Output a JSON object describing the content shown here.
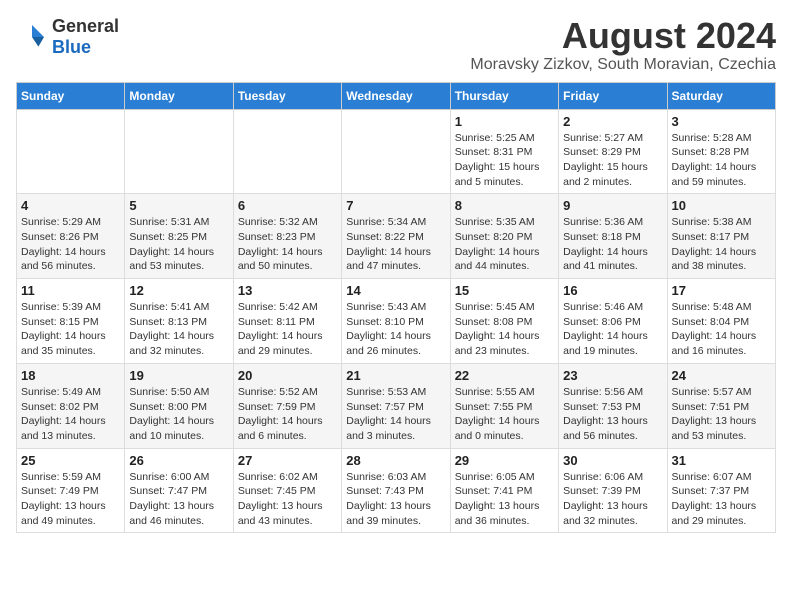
{
  "header": {
    "logo_general": "General",
    "logo_blue": "Blue",
    "title": "August 2024",
    "subtitle": "Moravsky Zizkov, South Moravian, Czechia"
  },
  "calendar": {
    "days_of_week": [
      "Sunday",
      "Monday",
      "Tuesday",
      "Wednesday",
      "Thursday",
      "Friday",
      "Saturday"
    ],
    "weeks": [
      {
        "cells": [
          {
            "day": "",
            "info": ""
          },
          {
            "day": "",
            "info": ""
          },
          {
            "day": "",
            "info": ""
          },
          {
            "day": "",
            "info": ""
          },
          {
            "day": "1",
            "info": "Sunrise: 5:25 AM\nSunset: 8:31 PM\nDaylight: 15 hours\nand 5 minutes."
          },
          {
            "day": "2",
            "info": "Sunrise: 5:27 AM\nSunset: 8:29 PM\nDaylight: 15 hours\nand 2 minutes."
          },
          {
            "day": "3",
            "info": "Sunrise: 5:28 AM\nSunset: 8:28 PM\nDaylight: 14 hours\nand 59 minutes."
          }
        ]
      },
      {
        "cells": [
          {
            "day": "4",
            "info": "Sunrise: 5:29 AM\nSunset: 8:26 PM\nDaylight: 14 hours\nand 56 minutes."
          },
          {
            "day": "5",
            "info": "Sunrise: 5:31 AM\nSunset: 8:25 PM\nDaylight: 14 hours\nand 53 minutes."
          },
          {
            "day": "6",
            "info": "Sunrise: 5:32 AM\nSunset: 8:23 PM\nDaylight: 14 hours\nand 50 minutes."
          },
          {
            "day": "7",
            "info": "Sunrise: 5:34 AM\nSunset: 8:22 PM\nDaylight: 14 hours\nand 47 minutes."
          },
          {
            "day": "8",
            "info": "Sunrise: 5:35 AM\nSunset: 8:20 PM\nDaylight: 14 hours\nand 44 minutes."
          },
          {
            "day": "9",
            "info": "Sunrise: 5:36 AM\nSunset: 8:18 PM\nDaylight: 14 hours\nand 41 minutes."
          },
          {
            "day": "10",
            "info": "Sunrise: 5:38 AM\nSunset: 8:17 PM\nDaylight: 14 hours\nand 38 minutes."
          }
        ]
      },
      {
        "cells": [
          {
            "day": "11",
            "info": "Sunrise: 5:39 AM\nSunset: 8:15 PM\nDaylight: 14 hours\nand 35 minutes."
          },
          {
            "day": "12",
            "info": "Sunrise: 5:41 AM\nSunset: 8:13 PM\nDaylight: 14 hours\nand 32 minutes."
          },
          {
            "day": "13",
            "info": "Sunrise: 5:42 AM\nSunset: 8:11 PM\nDaylight: 14 hours\nand 29 minutes."
          },
          {
            "day": "14",
            "info": "Sunrise: 5:43 AM\nSunset: 8:10 PM\nDaylight: 14 hours\nand 26 minutes."
          },
          {
            "day": "15",
            "info": "Sunrise: 5:45 AM\nSunset: 8:08 PM\nDaylight: 14 hours\nand 23 minutes."
          },
          {
            "day": "16",
            "info": "Sunrise: 5:46 AM\nSunset: 8:06 PM\nDaylight: 14 hours\nand 19 minutes."
          },
          {
            "day": "17",
            "info": "Sunrise: 5:48 AM\nSunset: 8:04 PM\nDaylight: 14 hours\nand 16 minutes."
          }
        ]
      },
      {
        "cells": [
          {
            "day": "18",
            "info": "Sunrise: 5:49 AM\nSunset: 8:02 PM\nDaylight: 14 hours\nand 13 minutes."
          },
          {
            "day": "19",
            "info": "Sunrise: 5:50 AM\nSunset: 8:00 PM\nDaylight: 14 hours\nand 10 minutes."
          },
          {
            "day": "20",
            "info": "Sunrise: 5:52 AM\nSunset: 7:59 PM\nDaylight: 14 hours\nand 6 minutes."
          },
          {
            "day": "21",
            "info": "Sunrise: 5:53 AM\nSunset: 7:57 PM\nDaylight: 14 hours\nand 3 minutes."
          },
          {
            "day": "22",
            "info": "Sunrise: 5:55 AM\nSunset: 7:55 PM\nDaylight: 14 hours\nand 0 minutes."
          },
          {
            "day": "23",
            "info": "Sunrise: 5:56 AM\nSunset: 7:53 PM\nDaylight: 13 hours\nand 56 minutes."
          },
          {
            "day": "24",
            "info": "Sunrise: 5:57 AM\nSunset: 7:51 PM\nDaylight: 13 hours\nand 53 minutes."
          }
        ]
      },
      {
        "cells": [
          {
            "day": "25",
            "info": "Sunrise: 5:59 AM\nSunset: 7:49 PM\nDaylight: 13 hours\nand 49 minutes."
          },
          {
            "day": "26",
            "info": "Sunrise: 6:00 AM\nSunset: 7:47 PM\nDaylight: 13 hours\nand 46 minutes."
          },
          {
            "day": "27",
            "info": "Sunrise: 6:02 AM\nSunset: 7:45 PM\nDaylight: 13 hours\nand 43 minutes."
          },
          {
            "day": "28",
            "info": "Sunrise: 6:03 AM\nSunset: 7:43 PM\nDaylight: 13 hours\nand 39 minutes."
          },
          {
            "day": "29",
            "info": "Sunrise: 6:05 AM\nSunset: 7:41 PM\nDaylight: 13 hours\nand 36 minutes."
          },
          {
            "day": "30",
            "info": "Sunrise: 6:06 AM\nSunset: 7:39 PM\nDaylight: 13 hours\nand 32 minutes."
          },
          {
            "day": "31",
            "info": "Sunrise: 6:07 AM\nSunset: 7:37 PM\nDaylight: 13 hours\nand 29 minutes."
          }
        ]
      }
    ]
  }
}
